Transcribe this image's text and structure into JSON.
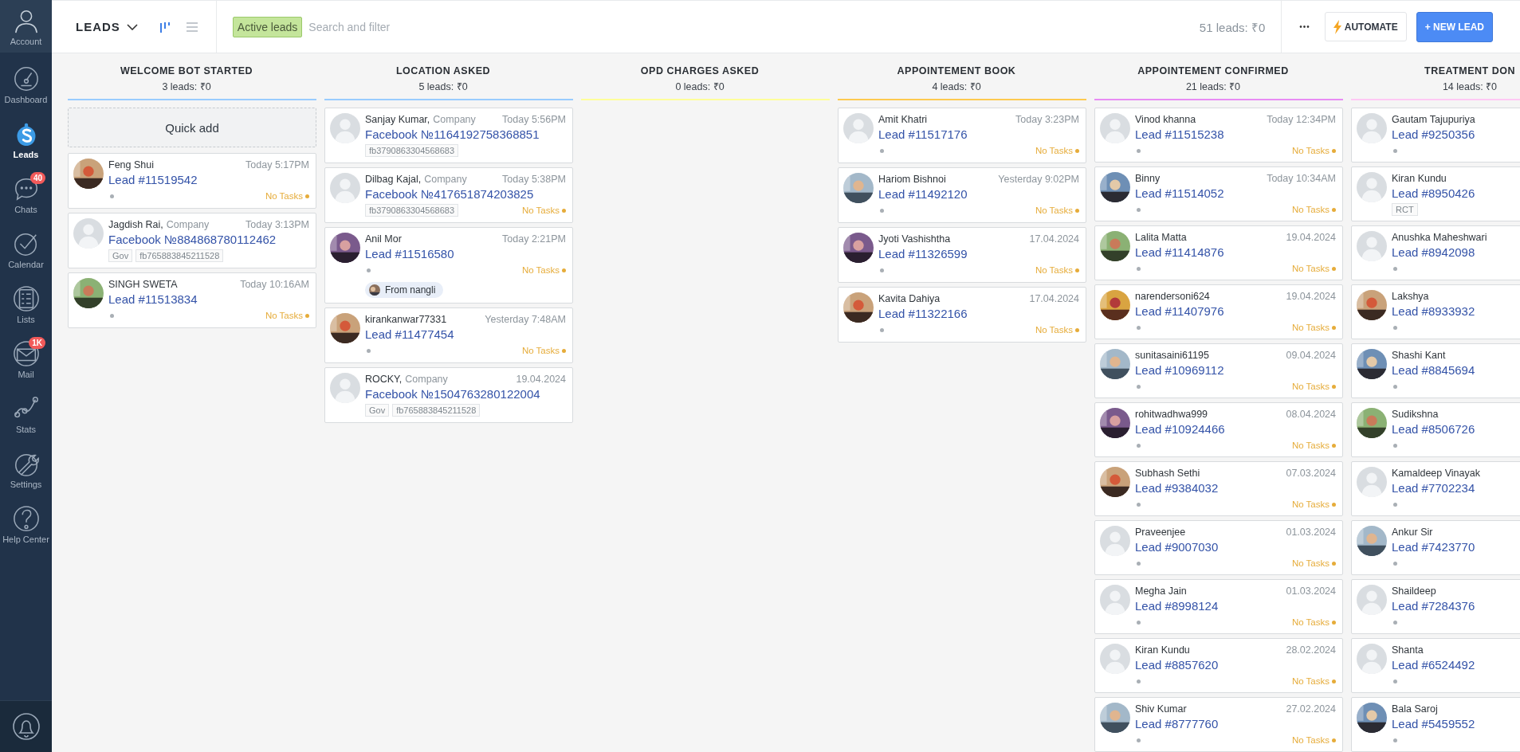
{
  "sidebar": {
    "items": [
      {
        "kind": "account",
        "label": "Account",
        "selected": false
      },
      {
        "kind": "dashboard",
        "label": "Dashboard",
        "selected": false
      },
      {
        "kind": "leads",
        "label": "Leads",
        "selected": true
      },
      {
        "kind": "chats",
        "label": "Chats",
        "selected": false,
        "badge": "40"
      },
      {
        "kind": "calendar",
        "label": "Calendar",
        "selected": false
      },
      {
        "kind": "lists",
        "label": "Lists",
        "selected": false
      },
      {
        "kind": "mail",
        "label": "Mail",
        "selected": false,
        "badge": "1K"
      },
      {
        "kind": "stats",
        "label": "Stats",
        "selected": false
      },
      {
        "kind": "settings",
        "label": "Settings",
        "selected": false
      },
      {
        "kind": "help",
        "label": "Help Center",
        "selected": false
      }
    ]
  },
  "header": {
    "title": "LEADS",
    "views": [
      {
        "kind": "pipeline",
        "selected": true
      },
      {
        "kind": "list",
        "selected": false
      }
    ],
    "filter_tag": "Active leads",
    "search": {
      "placeholder": "Search and filter"
    },
    "summary": "51 leads: ₹0",
    "more": "•••",
    "automate": "AUTOMATE",
    "new_lead": "+ NEW LEAD"
  },
  "columns": [
    {
      "title": "WELCOME BOT STARTED",
      "summary": "3 leads: ₹0",
      "color": "#99ccff",
      "quick_add": "Quick add",
      "cards": [
        {
          "name": "Feng Shui",
          "time": "Today 5:17PM",
          "lead": "Lead #11519542",
          "tasks": "No Tasks"
        },
        {
          "name": "Jagdish Rai,",
          "company": "Company",
          "time": "Today 3:13PM",
          "lead": "Facebook №884868780112462",
          "kind": "default",
          "tags": [
            "Gov",
            "fb765883845211528"
          ]
        },
        {
          "name": "SINGH SWETA",
          "time": "Today 10:16AM",
          "lead": "Lead #11513834",
          "tasks": "No Tasks"
        }
      ]
    },
    {
      "title": "LOCATION ASKED",
      "summary": "5 leads: ₹0",
      "color": "#99ccff",
      "cards": [
        {
          "name": "Sanjay Kumar,",
          "company": "Company",
          "time": "Today 5:56PM",
          "lead": "Facebook №1164192758368851",
          "kind": "default",
          "tags": [
            "fb3790863304568683"
          ]
        },
        {
          "name": "Dilbag Kajal,",
          "company": "Company",
          "time": "Today 5:38PM",
          "lead": "Facebook №417651874203825",
          "kind": "default",
          "tags": [
            "fb3790863304568683"
          ],
          "tasks": "No Tasks"
        },
        {
          "name": "Anil Mor",
          "time": "Today 2:21PM",
          "lead": "Lead #11516580",
          "tasks": "No Tasks",
          "note": "From nangli"
        },
        {
          "name": "kirankanwar77331",
          "time": "Yesterday 7:48AM",
          "lead": "Lead #11477454",
          "tasks": "No Tasks"
        },
        {
          "name": "ROCKY,",
          "company": "Company",
          "time": "19.04.2024",
          "lead": "Facebook №1504763280122004",
          "kind": "default",
          "tags": [
            "Gov",
            "fb765883845211528"
          ]
        }
      ]
    },
    {
      "title": "OPD CHARGES ASKED",
      "summary": "0 leads: ₹0",
      "color": "#ffff99"
    },
    {
      "title": "APPOINTEMENT BOOK",
      "summary": "4 leads: ₹0",
      "color": "#fdca50",
      "cards": [
        {
          "name": "Amit Khatri",
          "time": "Today 3:23PM",
          "lead": "Lead #11517176",
          "kind": "default",
          "tasks": "No Tasks"
        },
        {
          "name": "Hariom Bishnoi",
          "time": "Yesterday 9:02PM",
          "lead": "Lead #11492120",
          "tasks": "No Tasks"
        },
        {
          "name": "Jyoti Vashishtha",
          "time": "17.04.2024",
          "lead": "Lead #11326599",
          "tasks": "No Tasks"
        },
        {
          "name": "Kavita Dahiya",
          "time": "17.04.2024",
          "lead": "Lead #11322166",
          "tasks": "No Tasks"
        }
      ]
    },
    {
      "title": "APPOINTEMENT CONFIRMED",
      "summary": "21 leads: ₹0",
      "color": "#e88cf4",
      "cards": [
        {
          "name": "Vinod khanna",
          "time": "Today 12:34PM",
          "lead": "Lead #11515238",
          "kind": "default",
          "tasks": "No Tasks"
        },
        {
          "name": "Binny",
          "time": "Today 10:34AM",
          "lead": "Lead #11514052",
          "tasks": "No Tasks"
        },
        {
          "name": "Lalita Matta",
          "time": "19.04.2024",
          "lead": "Lead #11414876",
          "tasks": "No Tasks"
        },
        {
          "name": "narendersoni624",
          "time": "19.04.2024",
          "lead": "Lead #11407976",
          "tasks": "No Tasks"
        },
        {
          "name": "sunitasaini61195",
          "time": "09.04.2024",
          "lead": "Lead #10969112",
          "tasks": "No Tasks"
        },
        {
          "name": "rohitwadhwa999",
          "time": "08.04.2024",
          "lead": "Lead #10924466",
          "tasks": "No Tasks"
        },
        {
          "name": "Subhash Sethi",
          "time": "07.03.2024",
          "lead": "Lead #9384032",
          "tasks": "No Tasks"
        },
        {
          "name": "Praveenjee",
          "time": "01.03.2024",
          "lead": "Lead #9007030",
          "kind": "default",
          "tasks": "No Tasks"
        },
        {
          "name": "Megha Jain",
          "time": "01.03.2024",
          "lead": "Lead #8998124",
          "kind": "default",
          "tasks": "No Tasks"
        },
        {
          "name": "Kiran Kundu",
          "time": "28.02.2024",
          "lead": "Lead #8857620",
          "kind": "default",
          "tasks": "No Tasks"
        },
        {
          "name": "Shiv Kumar",
          "time": "27.02.2024",
          "lead": "Lead #8777760",
          "tasks": "No Tasks"
        }
      ]
    },
    {
      "title": "TREATMENT DON",
      "summary": "14 leads: ₹0",
      "color": "#ffc8f4",
      "cards": [
        {
          "name": "Gautam Tajupuriya",
          "lead": "Lead #9250356",
          "kind": "default"
        },
        {
          "name": "Kiran Kundu",
          "lead": "Lead #8950426",
          "kind": "default",
          "tags": [
            "RCT"
          ]
        },
        {
          "name": "Anushka Maheshwari",
          "lead": "Lead #8942098",
          "kind": "default"
        },
        {
          "name": "Lakshya",
          "lead": "Lead #8933932"
        },
        {
          "name": "Shashi Kant",
          "lead": "Lead #8845694"
        },
        {
          "name": "Sudikshna",
          "lead": "Lead #8506726"
        },
        {
          "name": "Kamaldeep Vinayak",
          "lead": "Lead #7702234",
          "kind": "default"
        },
        {
          "name": "Ankur Sir",
          "lead": "Lead #7423770"
        },
        {
          "name": "Shaildeep",
          "lead": "Lead #7284376",
          "kind": "default"
        },
        {
          "name": "Shanta",
          "lead": "Lead #6524492",
          "kind": "default"
        },
        {
          "name": "Bala Saroj",
          "lead": "Lead #5459552"
        }
      ]
    }
  ]
}
